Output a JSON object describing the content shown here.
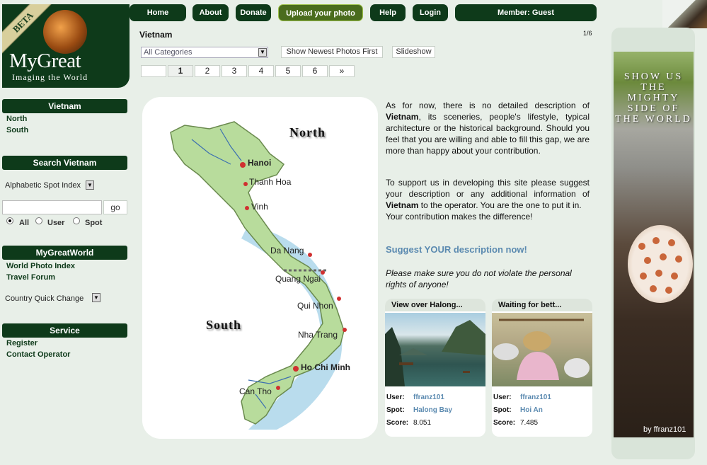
{
  "logo": {
    "beta": "BETA",
    "brand": "MyGreat",
    "tagline": "Imaging the World"
  },
  "nav": {
    "home": "Home",
    "about": "About",
    "donate": "Donate",
    "upload": "Upload your photo",
    "help": "Help",
    "login": "Login",
    "member": "Member: Guest"
  },
  "content": {
    "title": "Vietnam",
    "page_info": "1/6",
    "category_select": "All Categories",
    "newest_button": "Show Newest Photos First",
    "slideshow_button": "Slideshow",
    "pages": [
      "1",
      "2",
      "3",
      "4",
      "5",
      "6"
    ],
    "next": "»"
  },
  "sidebar": {
    "country_head": "Vietnam",
    "north": "North",
    "south": "South",
    "search_head": "Search Vietnam",
    "spot_index": "Alphabetic Spot Index",
    "go": "go",
    "radio_all": "All",
    "radio_user": "User",
    "radio_spot": "Spot",
    "world_head": "MyGreatWorld",
    "world_index": "World Photo Index",
    "travel_forum": "Travel Forum",
    "quick_change": "Country Quick Change",
    "service_head": "Service",
    "register": "Register",
    "contact": "Contact Operator"
  },
  "map": {
    "north": "North",
    "south": "South",
    "cities": [
      "Hanoi",
      "Thanh Hoa",
      "Vinh",
      "Da Nang",
      "Quang Ngai",
      "Qui Nhon",
      "Nha Trang",
      "Ho Chi Minh",
      "Can Tho"
    ]
  },
  "description": {
    "p1_a": "As for now, there is no detailed description of ",
    "p1_b": "Vietnam",
    "p1_c": ", its sceneries, people's lifestyle, typical architecture or the historical background. Should you feel that you are willing and able to fill this gap, we are more than happy about your contribution.",
    "p2_a": "To support us in developing this site please suggest your description or any additional information of ",
    "p2_b": "Vietnam",
    "p2_c": " to the operator. You are the one to put it in.",
    "p2_d": "Your contribution makes the difference!",
    "suggest_link": "Suggest YOUR description now!",
    "warning": "Please make sure you do not violate the personal rights of anyone!"
  },
  "cards": [
    {
      "title": "View over Halong...",
      "user_label": "User:",
      "user": "ffranz101",
      "spot_label": "Spot:",
      "spot": "Halong Bay",
      "score_label": "Score:",
      "score": "8.051"
    },
    {
      "title": "Waiting for bett...",
      "user_label": "User:",
      "user": "ffranz101",
      "spot_label": "Spot:",
      "spot": "Hoi An",
      "score_label": "Score:",
      "score": "7.485"
    }
  ],
  "banner": {
    "text": "SHOW US THE MIGHTY SIDE OF THE WORLD",
    "byline": "by ffranz101"
  }
}
